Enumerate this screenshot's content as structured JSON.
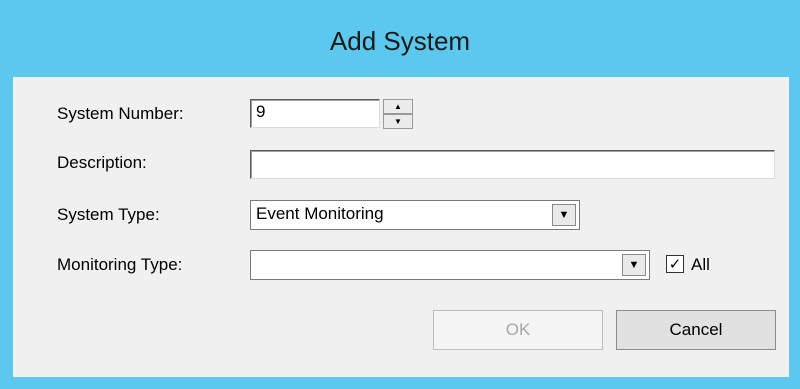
{
  "window": {
    "title": "Add System",
    "accent_color": "#5cc8ee"
  },
  "form": {
    "system_number": {
      "label": "System Number:",
      "value": "9"
    },
    "description": {
      "label": "Description:",
      "value": ""
    },
    "system_type": {
      "label": "System Type:",
      "value": "Event Monitoring"
    },
    "monitoring_type": {
      "label": "Monitoring Type:",
      "value": ""
    },
    "all_checkbox": {
      "label": "All",
      "checked": true,
      "mark": "✓"
    }
  },
  "buttons": {
    "ok_label": "OK",
    "ok_enabled": false,
    "cancel_label": "Cancel"
  },
  "icons": {
    "spin_up": "▲",
    "spin_down": "▼",
    "dropdown": "▼"
  }
}
